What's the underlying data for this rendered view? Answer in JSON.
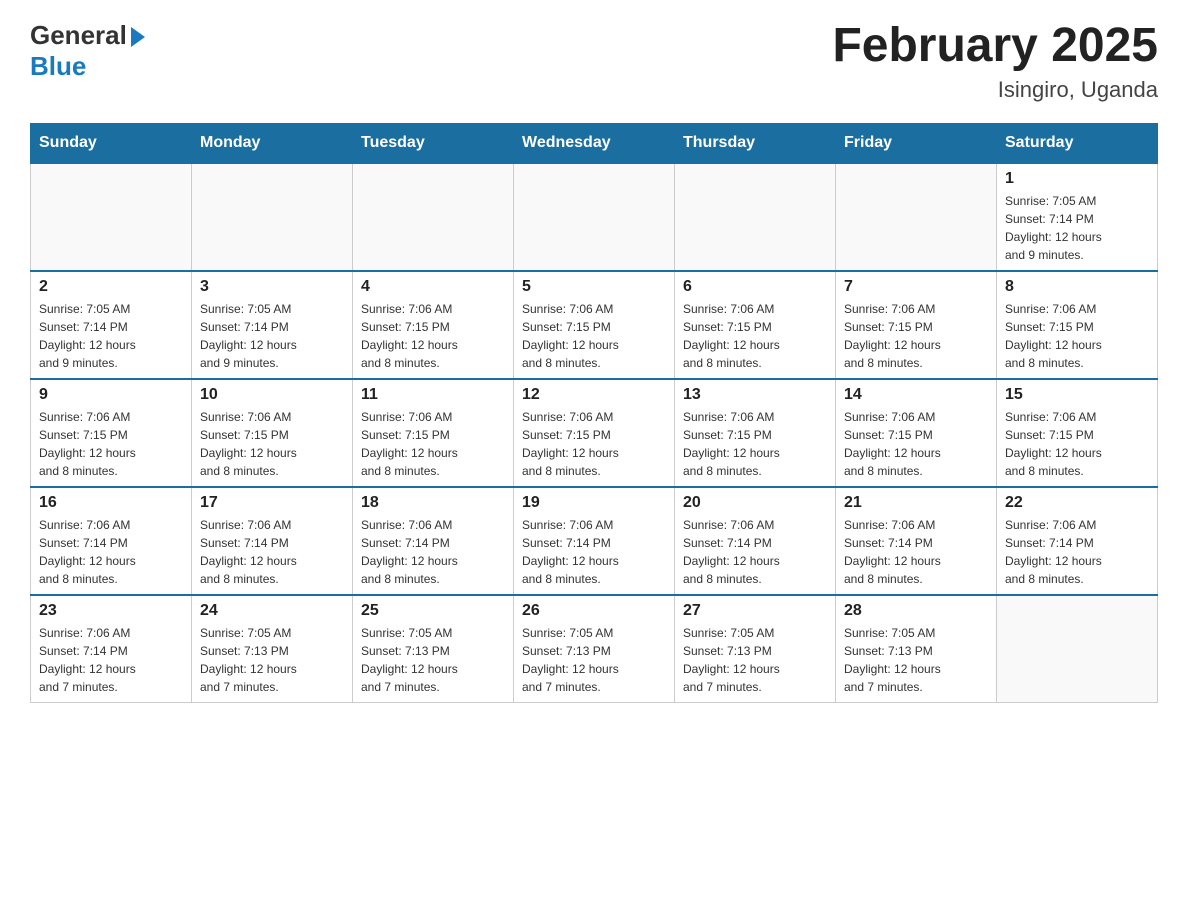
{
  "header": {
    "logo_general": "General",
    "logo_blue": "Blue",
    "title": "February 2025",
    "subtitle": "Isingiro, Uganda"
  },
  "days_of_week": [
    "Sunday",
    "Monday",
    "Tuesday",
    "Wednesday",
    "Thursday",
    "Friday",
    "Saturday"
  ],
  "weeks": [
    {
      "days": [
        {
          "number": "",
          "info": ""
        },
        {
          "number": "",
          "info": ""
        },
        {
          "number": "",
          "info": ""
        },
        {
          "number": "",
          "info": ""
        },
        {
          "number": "",
          "info": ""
        },
        {
          "number": "",
          "info": ""
        },
        {
          "number": "1",
          "info": "Sunrise: 7:05 AM\nSunset: 7:14 PM\nDaylight: 12 hours\nand 9 minutes."
        }
      ]
    },
    {
      "days": [
        {
          "number": "2",
          "info": "Sunrise: 7:05 AM\nSunset: 7:14 PM\nDaylight: 12 hours\nand 9 minutes."
        },
        {
          "number": "3",
          "info": "Sunrise: 7:05 AM\nSunset: 7:14 PM\nDaylight: 12 hours\nand 9 minutes."
        },
        {
          "number": "4",
          "info": "Sunrise: 7:06 AM\nSunset: 7:15 PM\nDaylight: 12 hours\nand 8 minutes."
        },
        {
          "number": "5",
          "info": "Sunrise: 7:06 AM\nSunset: 7:15 PM\nDaylight: 12 hours\nand 8 minutes."
        },
        {
          "number": "6",
          "info": "Sunrise: 7:06 AM\nSunset: 7:15 PM\nDaylight: 12 hours\nand 8 minutes."
        },
        {
          "number": "7",
          "info": "Sunrise: 7:06 AM\nSunset: 7:15 PM\nDaylight: 12 hours\nand 8 minutes."
        },
        {
          "number": "8",
          "info": "Sunrise: 7:06 AM\nSunset: 7:15 PM\nDaylight: 12 hours\nand 8 minutes."
        }
      ]
    },
    {
      "days": [
        {
          "number": "9",
          "info": "Sunrise: 7:06 AM\nSunset: 7:15 PM\nDaylight: 12 hours\nand 8 minutes."
        },
        {
          "number": "10",
          "info": "Sunrise: 7:06 AM\nSunset: 7:15 PM\nDaylight: 12 hours\nand 8 minutes."
        },
        {
          "number": "11",
          "info": "Sunrise: 7:06 AM\nSunset: 7:15 PM\nDaylight: 12 hours\nand 8 minutes."
        },
        {
          "number": "12",
          "info": "Sunrise: 7:06 AM\nSunset: 7:15 PM\nDaylight: 12 hours\nand 8 minutes."
        },
        {
          "number": "13",
          "info": "Sunrise: 7:06 AM\nSunset: 7:15 PM\nDaylight: 12 hours\nand 8 minutes."
        },
        {
          "number": "14",
          "info": "Sunrise: 7:06 AM\nSunset: 7:15 PM\nDaylight: 12 hours\nand 8 minutes."
        },
        {
          "number": "15",
          "info": "Sunrise: 7:06 AM\nSunset: 7:15 PM\nDaylight: 12 hours\nand 8 minutes."
        }
      ]
    },
    {
      "days": [
        {
          "number": "16",
          "info": "Sunrise: 7:06 AM\nSunset: 7:14 PM\nDaylight: 12 hours\nand 8 minutes."
        },
        {
          "number": "17",
          "info": "Sunrise: 7:06 AM\nSunset: 7:14 PM\nDaylight: 12 hours\nand 8 minutes."
        },
        {
          "number": "18",
          "info": "Sunrise: 7:06 AM\nSunset: 7:14 PM\nDaylight: 12 hours\nand 8 minutes."
        },
        {
          "number": "19",
          "info": "Sunrise: 7:06 AM\nSunset: 7:14 PM\nDaylight: 12 hours\nand 8 minutes."
        },
        {
          "number": "20",
          "info": "Sunrise: 7:06 AM\nSunset: 7:14 PM\nDaylight: 12 hours\nand 8 minutes."
        },
        {
          "number": "21",
          "info": "Sunrise: 7:06 AM\nSunset: 7:14 PM\nDaylight: 12 hours\nand 8 minutes."
        },
        {
          "number": "22",
          "info": "Sunrise: 7:06 AM\nSunset: 7:14 PM\nDaylight: 12 hours\nand 8 minutes."
        }
      ]
    },
    {
      "days": [
        {
          "number": "23",
          "info": "Sunrise: 7:06 AM\nSunset: 7:14 PM\nDaylight: 12 hours\nand 7 minutes."
        },
        {
          "number": "24",
          "info": "Sunrise: 7:05 AM\nSunset: 7:13 PM\nDaylight: 12 hours\nand 7 minutes."
        },
        {
          "number": "25",
          "info": "Sunrise: 7:05 AM\nSunset: 7:13 PM\nDaylight: 12 hours\nand 7 minutes."
        },
        {
          "number": "26",
          "info": "Sunrise: 7:05 AM\nSunset: 7:13 PM\nDaylight: 12 hours\nand 7 minutes."
        },
        {
          "number": "27",
          "info": "Sunrise: 7:05 AM\nSunset: 7:13 PM\nDaylight: 12 hours\nand 7 minutes."
        },
        {
          "number": "28",
          "info": "Sunrise: 7:05 AM\nSunset: 7:13 PM\nDaylight: 12 hours\nand 7 minutes."
        },
        {
          "number": "",
          "info": ""
        }
      ]
    }
  ]
}
